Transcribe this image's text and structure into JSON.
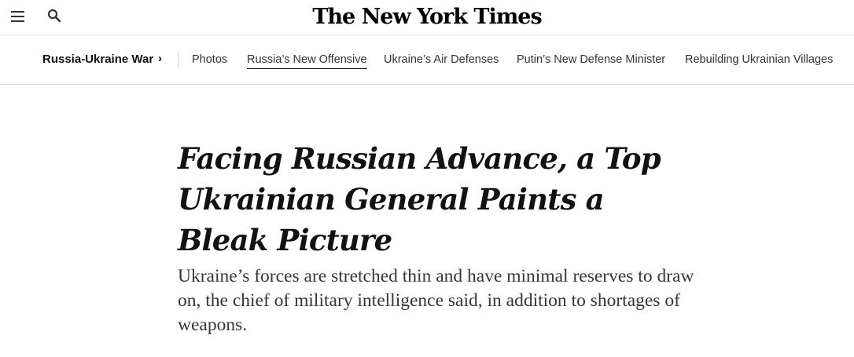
{
  "header": {
    "logo_text": "The New York Times",
    "icons": {
      "menu": "hamburger-menu-icon",
      "search": "search-icon"
    }
  },
  "section_nav": {
    "title": "Russia-Ukraine War",
    "chevron": "›",
    "links": [
      {
        "label": "Photos",
        "active": false
      },
      {
        "label": "Russia’s New Offensive",
        "active": true
      },
      {
        "label": "Ukraine’s Air Defenses",
        "active": false
      },
      {
        "label": "Putin’s New Defense Minister",
        "active": false
      },
      {
        "label": "Rebuilding Ukrainian Villages",
        "active": false
      }
    ]
  },
  "article": {
    "headline": "Facing Russian Advance, a Top Ukrainian General Paints a Bleak Picture",
    "summary": "Ukraine’s forces are stretched thin and have minimal reserves to draw on, the chief of military intelligence said, in addition to shortages of weapons."
  }
}
